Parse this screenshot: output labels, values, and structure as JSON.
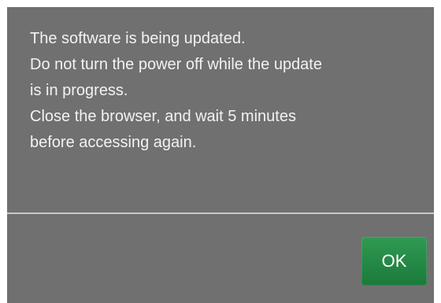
{
  "dialog": {
    "message_lines": [
      "The software is being updated.",
      "Do not turn the power off while the update",
      "is in progress.",
      "Close the browser, and wait 5 minutes",
      "before accessing again."
    ],
    "ok_label": "OK"
  },
  "colors": {
    "dialog_background": "#707070",
    "text": "#f2f2f2",
    "divider": "#c8c8c8",
    "ok_button": "#238a46"
  }
}
